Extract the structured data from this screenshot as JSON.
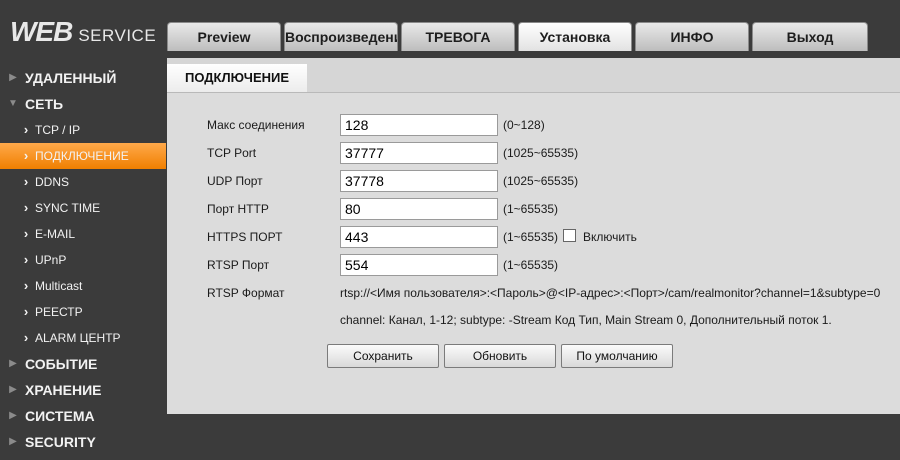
{
  "logo": {
    "text_main": "WEB",
    "text_sub": "SERVICE"
  },
  "tabs": [
    {
      "label": "Preview",
      "active": false
    },
    {
      "label": "Воспроизведение",
      "active": false
    },
    {
      "label": "ТРЕВОГА",
      "active": false
    },
    {
      "label": "Установка",
      "active": true
    },
    {
      "label": "ИНФО",
      "active": false
    },
    {
      "label": "Выход",
      "active": false
    }
  ],
  "sidebar": {
    "items": [
      {
        "label": "УДАЛЕННЫЙ",
        "level": "top",
        "expanded": false
      },
      {
        "label": "СЕТЬ",
        "level": "top",
        "expanded": true
      },
      {
        "label": "TCP / IP",
        "level": "sub"
      },
      {
        "label": "ПОДКЛЮЧЕНИЕ",
        "level": "sub",
        "active": true
      },
      {
        "label": "DDNS",
        "level": "sub"
      },
      {
        "label": "SYNC TIME",
        "level": "sub"
      },
      {
        "label": "E-MAIL",
        "level": "sub"
      },
      {
        "label": "UPnP",
        "level": "sub"
      },
      {
        "label": "Multicast",
        "level": "sub"
      },
      {
        "label": "РЕЕСТР",
        "level": "sub"
      },
      {
        "label": "ALARM ЦЕНТР",
        "level": "sub"
      },
      {
        "label": "СОБЫТИЕ",
        "level": "top",
        "expanded": false
      },
      {
        "label": "ХРАНЕНИЕ",
        "level": "top",
        "expanded": false
      },
      {
        "label": "СИСТЕМА",
        "level": "top",
        "expanded": false
      },
      {
        "label": "SECURITY",
        "level": "top",
        "expanded": false
      }
    ]
  },
  "section_title": "ПОДКЛЮЧЕНИЕ",
  "form": {
    "fields": [
      {
        "label": "Макс соединения",
        "value": "128",
        "range": "(0~128)"
      },
      {
        "label": "TCP Port",
        "value": "37777",
        "range": "(1025~65535)"
      },
      {
        "label": "UDP Порт",
        "value": "37778",
        "range": "(1025~65535)"
      },
      {
        "label": "Порт HTTP",
        "value": "80",
        "range": "(1~65535)"
      },
      {
        "label": "HTTPS ПОРТ",
        "value": "443",
        "range": "(1~65535)"
      },
      {
        "label": "RTSP Порт",
        "value": "554",
        "range": "(1~65535)"
      }
    ],
    "https_enable_label": "Включить",
    "https_enable_checked": false,
    "rtsp_format_label": "RTSP Формат",
    "rtsp_format_value": "rtsp://<Имя пользователя>:<Пароль>@<IP-адрес>:<Порт>/cam/realmonitor?channel=1&subtype=0",
    "rtsp_note": "channel: Канал, 1-12; subtype: -Stream Код Тип, Main Stream 0, Дополнительный поток 1."
  },
  "buttons": {
    "save": "Сохранить",
    "refresh": "Обновить",
    "default": "По умолчанию"
  },
  "colors": {
    "accent_active": "#f59a2c",
    "background": "#3b3b3b",
    "panel": "#dcdcdc"
  }
}
